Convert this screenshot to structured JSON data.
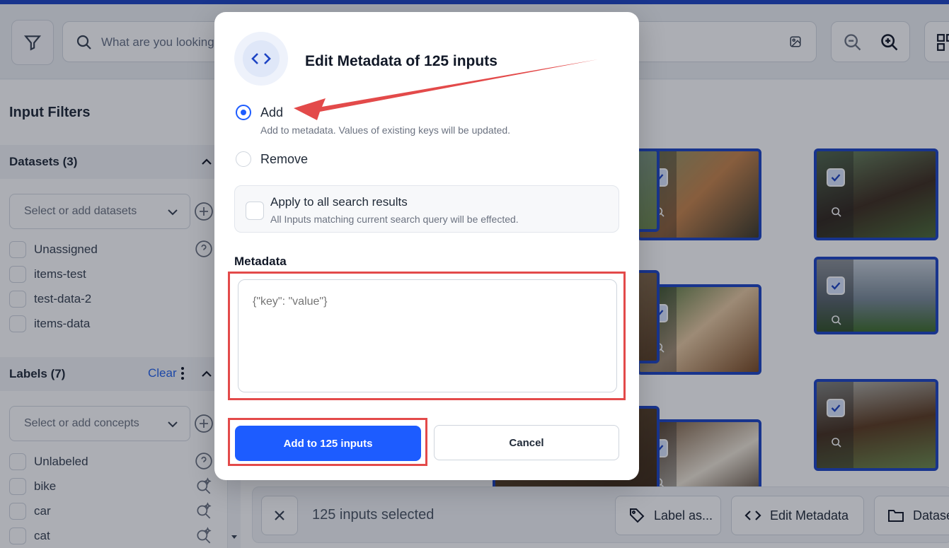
{
  "search": {
    "placeholder": "What are you looking"
  },
  "sidebar": {
    "title": "Input Filters",
    "datasets": {
      "header": "Datasets (3)",
      "select_placeholder": "Select or add datasets",
      "items": [
        "Unassigned",
        "items-test",
        "test-data-2",
        "items-data"
      ]
    },
    "labels": {
      "header": "Labels (7)",
      "clear": "Clear",
      "select_placeholder": "Select or add concepts",
      "items": [
        "Unlabeled",
        "bike",
        "car",
        "cat"
      ]
    }
  },
  "selection_bar": {
    "count": "125 inputs selected",
    "actions": [
      "Label as...",
      "Edit Metadata",
      "Datase"
    ]
  },
  "modal": {
    "title": "Edit Metadata of 125 inputs",
    "add_label": "Add",
    "add_desc": "Add to metadata. Values of existing keys will be updated.",
    "remove_label": "Remove",
    "apply_title": "Apply to all search results",
    "apply_desc": "All Inputs matching current search query will be effected.",
    "metadata_label": "Metadata",
    "metadata_placeholder": "{\"key\": \"value\"}",
    "submit": "Add to 125 inputs",
    "cancel": "Cancel"
  },
  "colors": {
    "primary": "#1d5cff",
    "selection_border": "#1d44c4",
    "annotation": "#e34a4a"
  }
}
